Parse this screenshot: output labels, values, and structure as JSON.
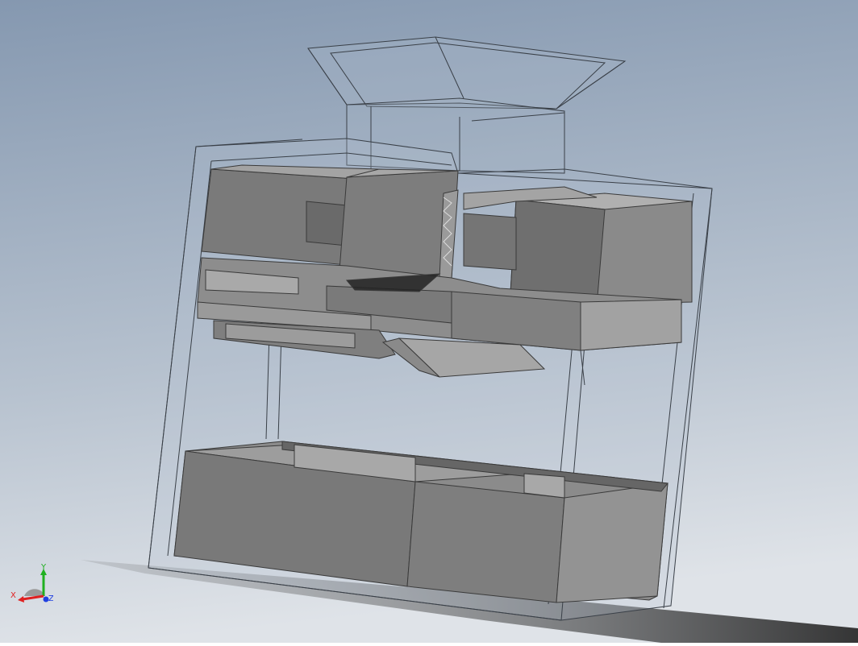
{
  "scene": {
    "description_colors": {
      "background_top": "#8a9db4",
      "background_bottom": "#d4dae2",
      "glass_edge": "#3a4048",
      "solid_face_dark": "#6e6e6e",
      "solid_face_mid": "#878787",
      "solid_face_light": "#a8a8a8",
      "shadow": "#3a3a3a"
    }
  },
  "triad": {
    "x_label": "X",
    "y_label": "Y",
    "z_label": "Z",
    "x_color": "#e02020",
    "y_color": "#20b020",
    "z_color": "#2040e0"
  }
}
